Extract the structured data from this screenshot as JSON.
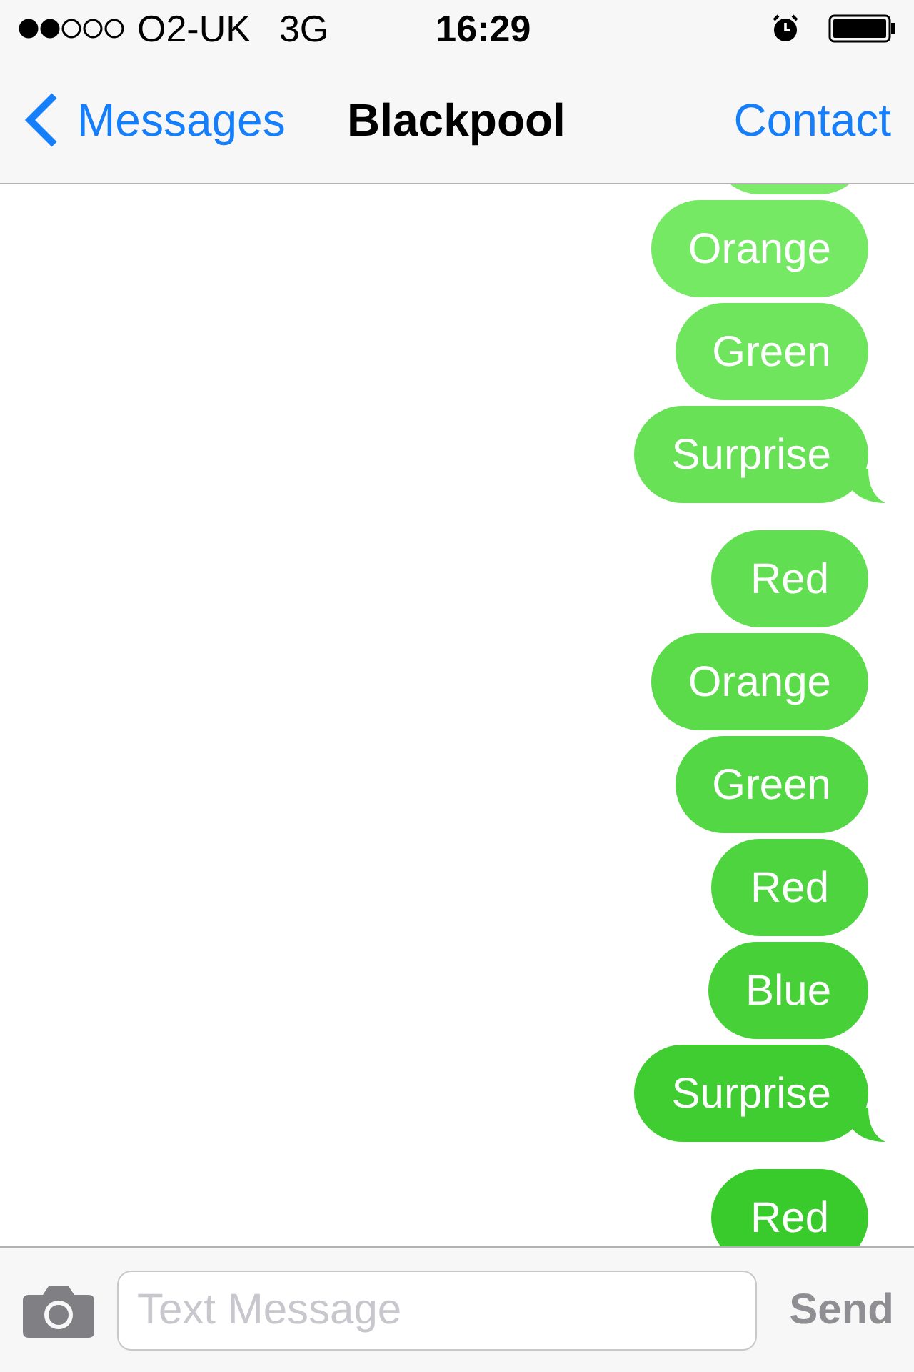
{
  "status_bar": {
    "carrier": "O2-UK",
    "network": "3G",
    "time": "16:29"
  },
  "nav_bar": {
    "back": "Messages",
    "title": "Blackpool",
    "action": "Contact"
  },
  "messages": [
    {
      "tail": false
    },
    {
      "text": "Orange",
      "tail": false
    },
    {
      "text": "Green",
      "tail": false
    },
    {
      "text": "Surprise",
      "tail": true
    },
    {
      "text": "Red",
      "tail": false
    },
    {
      "text": "Orange",
      "tail": false
    },
    {
      "text": "Green",
      "tail": false
    },
    {
      "text": "Red",
      "tail": false
    },
    {
      "text": "Blue",
      "tail": false
    },
    {
      "text": "Surprise",
      "tail": true
    },
    {
      "text": "Red",
      "tail": false
    }
  ],
  "composer": {
    "placeholder": "Text Message",
    "send": "Send",
    "send_disabled": true
  }
}
